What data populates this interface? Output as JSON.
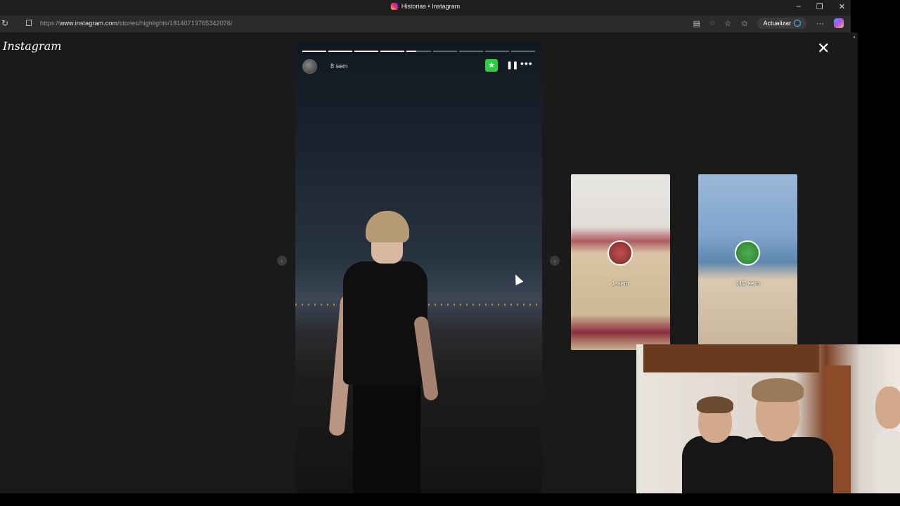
{
  "browser": {
    "tab_title": "Historias • Instagram",
    "url_prefix": "https://",
    "url_domain": "www.instagram.com",
    "url_path": "/stories/highlights/18140713765342076/",
    "update_label": "Actualizar",
    "window_controls": [
      "minimize",
      "restore",
      "close"
    ]
  },
  "page": {
    "logo": "Instagram",
    "close_glyph": "✕"
  },
  "story": {
    "segments": 9,
    "segments_done": 4,
    "current_segment_progress": 0.4,
    "time_ago": "8 sem",
    "close_friends_glyph": "★",
    "pause_glyph": "❚❚",
    "more_glyph": "•••",
    "accent_close_friends": "#2ecc40"
  },
  "previews": [
    {
      "label": "1 sem"
    },
    {
      "label": "112 sem"
    }
  ],
  "nav": {
    "prev_glyph": "‹",
    "next_glyph": "›"
  }
}
